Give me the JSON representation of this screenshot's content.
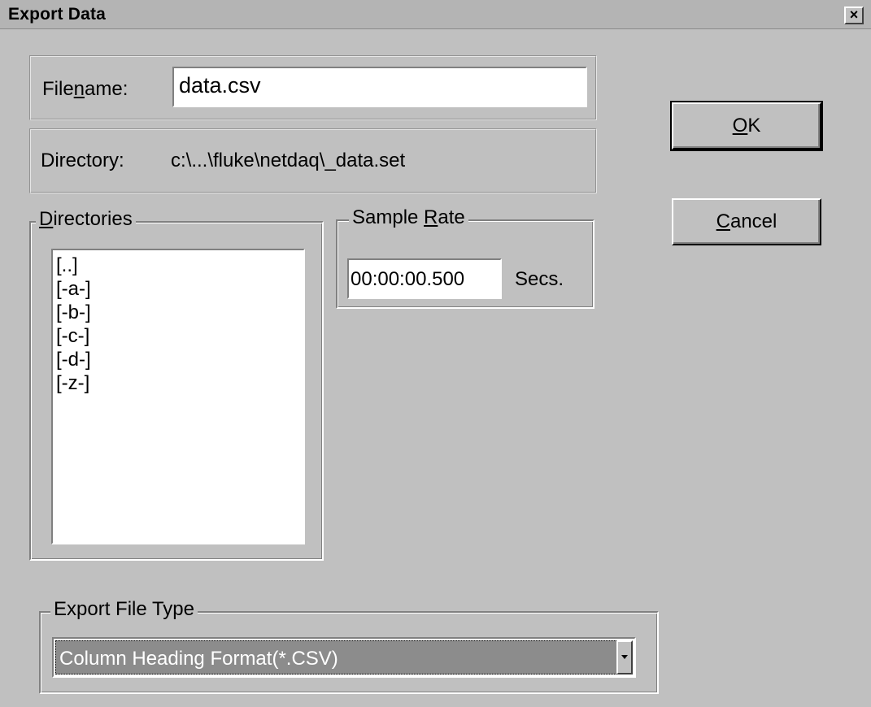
{
  "window": {
    "title": "Export Data",
    "close_glyph": "×"
  },
  "filename": {
    "label_pre": "File",
    "label_accel": "n",
    "label_post": "ame:",
    "value": "data.csv"
  },
  "directory": {
    "label": "Directory:",
    "value": "c:\\...\\fluke\\netdaq\\_data.set"
  },
  "directories": {
    "caption_accel": "D",
    "caption_rest": "irectories",
    "items": [
      "[..]",
      "[-a-]",
      "[-b-]",
      "[-c-]",
      "[-d-]",
      "[-z-]"
    ]
  },
  "sample_rate": {
    "caption_pre": "Sample ",
    "caption_accel": "R",
    "caption_post": "ate",
    "value": "00:00:00.500",
    "unit": "Secs."
  },
  "buttons": {
    "ok_accel": "O",
    "ok_rest": "K",
    "cancel_accel": "C",
    "cancel_rest": "ancel"
  },
  "export_file_type": {
    "caption": "Export File Type",
    "selected": "Column Heading Format(*.CSV)"
  },
  "icons": {
    "close": "close-icon",
    "dropdown": "chevron-down-icon"
  }
}
